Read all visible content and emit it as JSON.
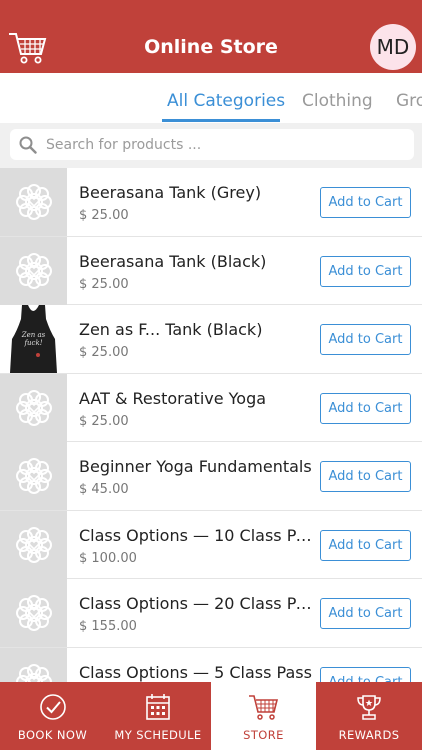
{
  "header": {
    "title": "Online Store",
    "avatar_initials": "MD",
    "bar_color": "#c0413a"
  },
  "tabs": [
    {
      "label": "All Categories",
      "active": true
    },
    {
      "label": "Clothing",
      "active": false
    },
    {
      "label": "Gro",
      "active": false
    }
  ],
  "search": {
    "placeholder": "Search for products ...",
    "value": ""
  },
  "products": [
    {
      "name": "Beerasana Tank (Grey)",
      "price": "$ 25.00",
      "image": "logo-placeholder",
      "button": "Add to Cart"
    },
    {
      "name": "Beerasana Tank (Black)",
      "price": "$ 25.00",
      "image": "logo-placeholder",
      "button": "Add to Cart"
    },
    {
      "name": "Zen as F... Tank (Black)",
      "price": "$ 25.00",
      "image": "black-tank-photo",
      "button": "Add to Cart"
    },
    {
      "name": "AAT & Restorative Yoga",
      "price": "$ 25.00",
      "image": "logo-placeholder",
      "button": "Add to Cart"
    },
    {
      "name": "Beginner Yoga Fundamentals",
      "price": "$ 45.00",
      "image": "logo-placeholder",
      "button": "Add to Cart"
    },
    {
      "name": "Class Options — 10 Class Pa...",
      "price": "$ 100.00",
      "image": "logo-placeholder",
      "button": "Add to Cart"
    },
    {
      "name": "Class Options — 20 Class Pa...",
      "price": "$ 155.00",
      "image": "logo-placeholder",
      "button": "Add to Cart"
    },
    {
      "name": "Class Options — 5 Class Pass",
      "price": "",
      "image": "logo-placeholder",
      "button": "Add to Cart"
    }
  ],
  "nav": [
    {
      "label": "BOOK NOW",
      "icon": "check-circle-icon",
      "active": false
    },
    {
      "label": "MY SCHEDULE",
      "icon": "calendar-icon",
      "active": false
    },
    {
      "label": "STORE",
      "icon": "cart-icon",
      "active": true
    },
    {
      "label": "REWARDS",
      "icon": "trophy-icon",
      "active": false
    }
  ],
  "colors": {
    "accent": "#3b8fd6",
    "brand": "#c0413a"
  }
}
